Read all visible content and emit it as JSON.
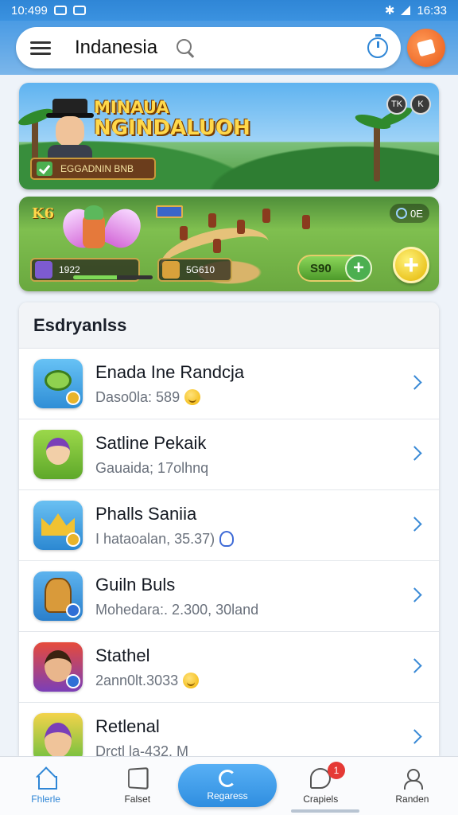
{
  "status_bar": {
    "time_left": "10:499",
    "time_right": "16:33"
  },
  "header": {
    "search_text": "Indanesia"
  },
  "banner1": {
    "title_line1": "MINAUA",
    "title_line2": "NGINDALUOH",
    "chip_text": "EGGADNIN BNB",
    "corner_icons": [
      "TK",
      "K"
    ]
  },
  "banner2": {
    "level": "K6",
    "stat1": "1922",
    "stat2": "5G610",
    "coin": "0E",
    "gold_value": "S90",
    "progress": 0.55
  },
  "list": {
    "header": "Esdryanlss",
    "items": [
      {
        "title": "Enada Ine Randcja",
        "subtitle": "Daso0la: 589",
        "trailing": "smile"
      },
      {
        "title": "Satline Pekaik",
        "subtitle": "Gauaida; 17olhnq",
        "trailing": "none"
      },
      {
        "title": "Phalls Saniia",
        "subtitle": "I hataoalan, 35.37)",
        "trailing": "hand"
      },
      {
        "title": "Guiln Buls",
        "subtitle": "Mohedara:. 2.300, 30land",
        "trailing": "none"
      },
      {
        "title": "Stathel",
        "subtitle": "2ann0lt.3033",
        "trailing": "smile"
      },
      {
        "title": "Retlenal",
        "subtitle": "Drctl la-432. M",
        "trailing": "none"
      }
    ]
  },
  "bottom_nav": {
    "items": [
      "Fhlerle",
      "Falset",
      "Regaress",
      "Crapiels",
      "Randen"
    ],
    "badge": "1"
  }
}
